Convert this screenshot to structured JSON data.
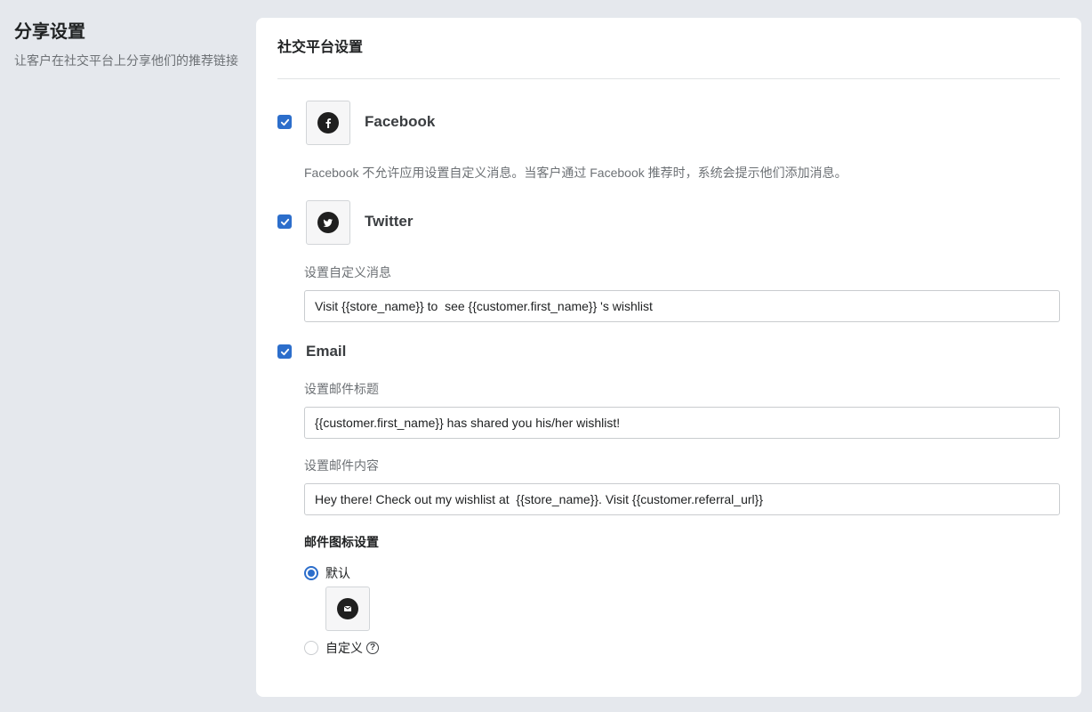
{
  "sidebar": {
    "title": "分享设置",
    "description": "让客户在社交平台上分享他们的推荐链接"
  },
  "card": {
    "title": "社交平台设置"
  },
  "platforms": {
    "facebook": {
      "name": "Facebook",
      "checked": true,
      "icon": "facebook-icon",
      "note": "Facebook 不允许应用设置自定义消息。当客户通过 Facebook 推荐时，系统会提示他们添加消息。"
    },
    "twitter": {
      "name": "Twitter",
      "checked": true,
      "icon": "twitter-icon",
      "message_label": "设置自定义消息",
      "message_value": "Visit {{store_name}} to  see {{customer.first_name}} 's wishlist"
    },
    "email": {
      "name": "Email",
      "checked": true,
      "subject_label": "设置邮件标题",
      "subject_value": "{{customer.first_name}} has shared you his/her wishlist!",
      "body_label": "设置邮件内容",
      "body_value": "Hey there! Check out my wishlist at  {{store_name}}. Visit {{customer.referral_url}}",
      "icon_settings": {
        "heading": "邮件图标设置",
        "default_label": "默认",
        "custom_label": "自定义",
        "selected": "默认",
        "default_icon": "mail-icon",
        "help": "?"
      }
    }
  },
  "colors": {
    "accent": "#2c6ecb",
    "page_bg": "#e5e8ed",
    "card_bg": "#ffffff",
    "muted_text": "#6d7175"
  }
}
